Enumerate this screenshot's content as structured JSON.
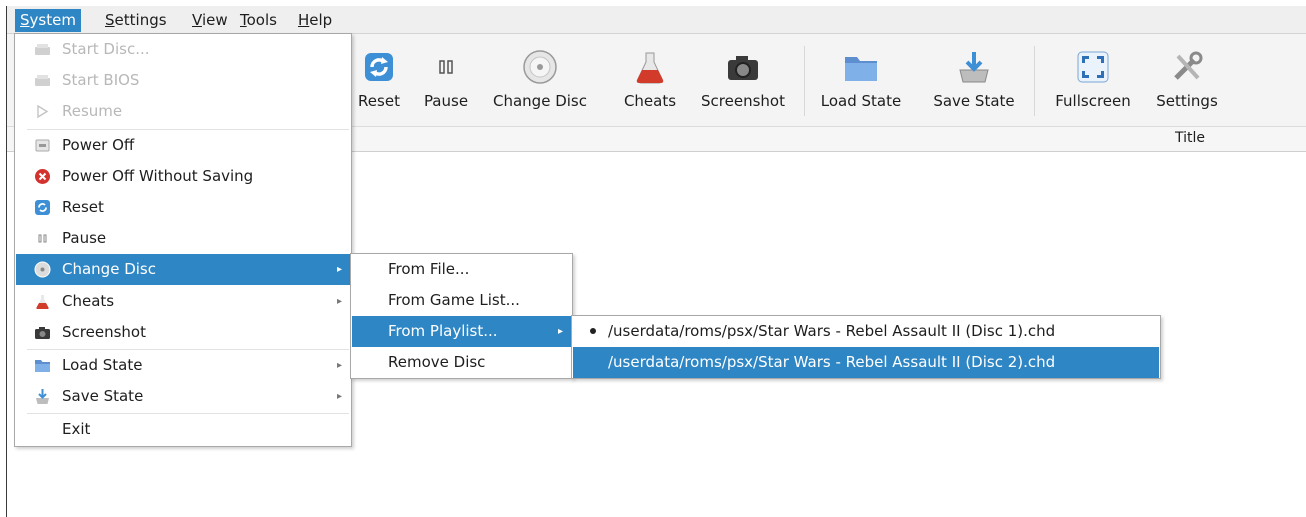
{
  "menubar": [
    {
      "label": "System",
      "mnemonic": "S",
      "rest": "ystem",
      "active": true
    },
    {
      "label": "Settings",
      "mnemonic": "S",
      "rest": "ettings",
      "active": false
    },
    {
      "label": "View",
      "mnemonic": "V",
      "rest": "iew",
      "active": false
    },
    {
      "label": "Tools",
      "mnemonic": "T",
      "rest": "ools",
      "active": false
    },
    {
      "label": "Help",
      "mnemonic": "H",
      "rest": "elp",
      "active": false
    }
  ],
  "toolbar": {
    "reset": "Reset",
    "pause": "Pause",
    "change_disc": "Change Disc",
    "cheats": "Cheats",
    "screenshot": "Screenshot",
    "load_state": "Load State",
    "save_state": "Save State",
    "fullscreen": "Fullscreen",
    "settings": "Settings"
  },
  "table": {
    "title_header": "Title"
  },
  "system_menu": {
    "start_disc": "Start Disc...",
    "start_bios": "Start BIOS",
    "resume": "Resume",
    "power_off": "Power Off",
    "power_off_without_saving": "Power Off Without Saving",
    "reset": "Reset",
    "pause": "Pause",
    "change_disc": "Change Disc",
    "cheats": "Cheats",
    "screenshot": "Screenshot",
    "load_state": "Load State",
    "save_state": "Save State",
    "exit": "Exit"
  },
  "change_disc_menu": {
    "from_file": "From File...",
    "from_game_list": "From Game List...",
    "from_playlist": "From Playlist...",
    "remove_disc": "Remove Disc"
  },
  "playlist_menu": {
    "items": [
      "/userdata/roms/psx/Star Wars - Rebel Assault II (Disc 1).chd",
      "/userdata/roms/psx/Star Wars - Rebel Assault II (Disc 2).chd"
    ],
    "current_index": 0,
    "highlighted_index": 1
  },
  "colors": {
    "highlight": "#2f86c4",
    "menubar_bg": "#efefef",
    "toolbar_bg": "#f4f4f4"
  }
}
